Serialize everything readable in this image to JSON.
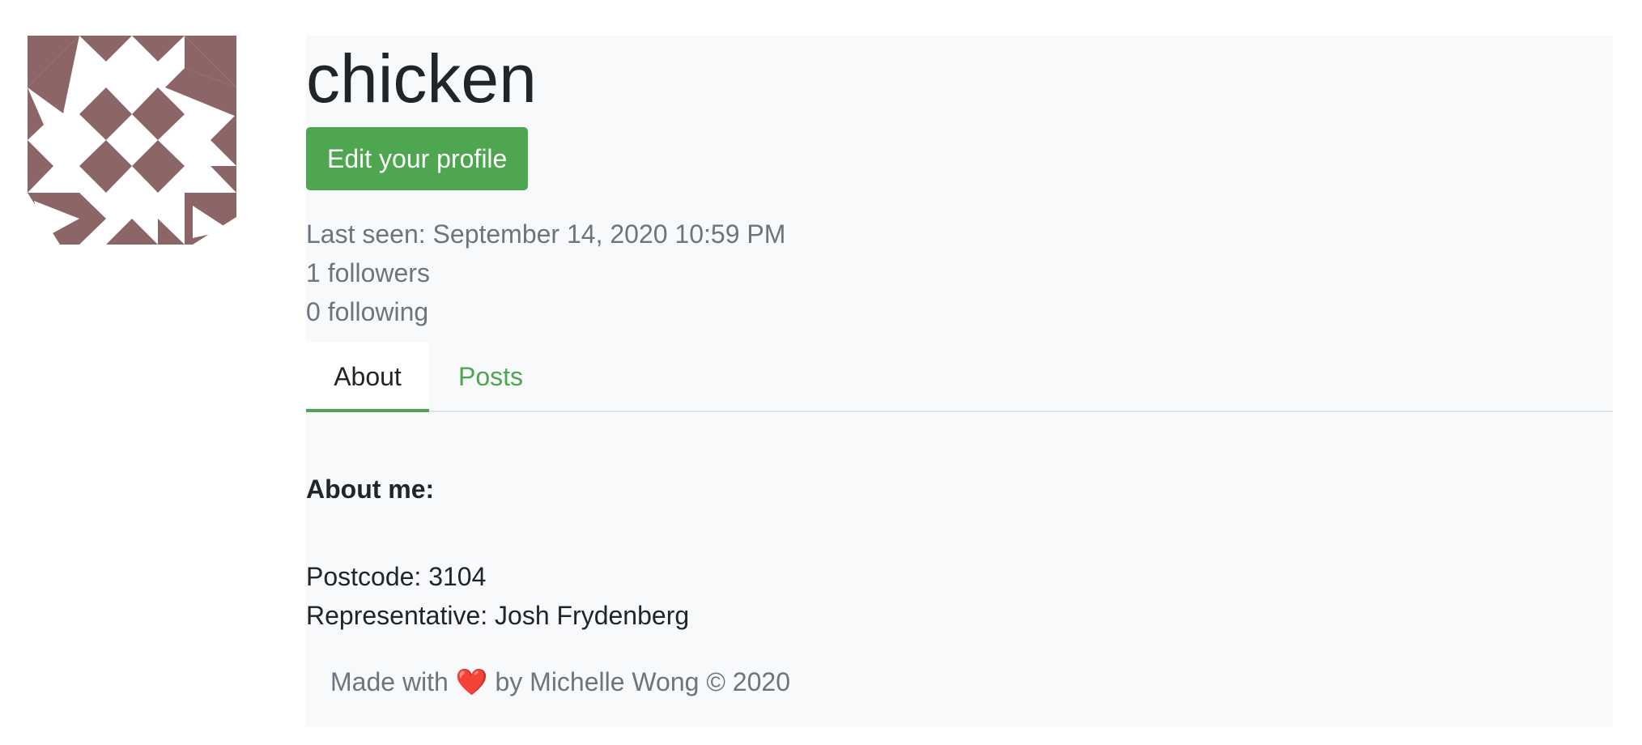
{
  "profile": {
    "username": "chicken",
    "edit_button": "Edit your profile",
    "last_seen": "Last seen: September 14, 2020 10:59 PM",
    "followers": "1 followers",
    "following": "0 following"
  },
  "tabs": [
    {
      "label": "About",
      "active": true
    },
    {
      "label": "Posts",
      "active": false
    }
  ],
  "about": {
    "heading": "About me:",
    "postcode": "Postcode: 3104",
    "representative": "Representative: Josh Frydenberg"
  },
  "footer": {
    "prefix": "Made with",
    "heart": "❤️",
    "suffix": "by Michelle Wong © 2020"
  },
  "colors": {
    "accent": "#4ea651",
    "avatar": "#8c6566",
    "panel_bg": "#f8f9fa",
    "muted_text": "#6c757d"
  },
  "icons": {
    "avatar": "identicon-avatar",
    "heart": "heart-icon"
  }
}
